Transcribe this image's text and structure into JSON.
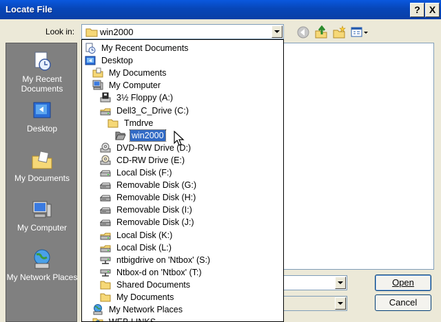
{
  "window": {
    "title": "Locate File",
    "help_label": "?",
    "close_label": "X"
  },
  "lookin": {
    "label": "Look in:",
    "value": "win2000"
  },
  "places": [
    {
      "label": "My Recent Documents",
      "icon": "recent-documents-icon"
    },
    {
      "label": "Desktop",
      "icon": "desktop-icon"
    },
    {
      "label": "My Documents",
      "icon": "my-documents-icon"
    },
    {
      "label": "My Computer",
      "icon": "my-computer-icon"
    },
    {
      "label": "My Network Places",
      "icon": "network-places-icon"
    }
  ],
  "dropdown_items": [
    {
      "label": "My Recent Documents",
      "icon": "recent-documents-icon",
      "indent": 0
    },
    {
      "label": "Desktop",
      "icon": "desktop-icon",
      "indent": 0
    },
    {
      "label": "My Documents",
      "icon": "folder-documents-icon",
      "indent": 1
    },
    {
      "label": "My Computer",
      "icon": "my-computer-icon",
      "indent": 1
    },
    {
      "label": "3½ Floppy (A:)",
      "icon": "floppy-drive-icon",
      "indent": 2
    },
    {
      "label": "Dell3_C_Drive (C:)",
      "icon": "hard-drive-icon",
      "indent": 2
    },
    {
      "label": "Tmdrve",
      "icon": "folder-icon",
      "indent": 3
    },
    {
      "label": "win2000",
      "icon": "folder-open-icon",
      "indent": 4,
      "selected": true
    },
    {
      "label": "DVD-RW Drive (D:)",
      "icon": "dvd-drive-icon",
      "indent": 2
    },
    {
      "label": "CD-RW Drive (E:)",
      "icon": "cd-drive-icon",
      "indent": 2
    },
    {
      "label": "Local Disk (F:)",
      "icon": "disk-icon",
      "indent": 2
    },
    {
      "label": "Removable Disk (G:)",
      "icon": "removable-disk-icon",
      "indent": 2
    },
    {
      "label": "Removable Disk (H:)",
      "icon": "removable-disk-icon",
      "indent": 2
    },
    {
      "label": "Removable Disk (I:)",
      "icon": "removable-disk-icon",
      "indent": 2
    },
    {
      "label": "Removable Disk (J:)",
      "icon": "removable-disk-icon",
      "indent": 2
    },
    {
      "label": "Local Disk (K:)",
      "icon": "hard-drive-icon",
      "indent": 2
    },
    {
      "label": "Local Disk (L:)",
      "icon": "hard-drive-icon",
      "indent": 2
    },
    {
      "label": "ntbigdrive on 'Ntbox' (S:)",
      "icon": "network-drive-icon",
      "indent": 2
    },
    {
      "label": "Ntbox-d on 'Ntbox' (T:)",
      "icon": "network-drive-icon",
      "indent": 2
    },
    {
      "label": "Shared Documents",
      "icon": "folder-icon",
      "indent": 2
    },
    {
      "label": "My Documents",
      "icon": "folder-icon",
      "indent": 2
    },
    {
      "label": "My Network Places",
      "icon": "network-places-icon",
      "indent": 1
    },
    {
      "label": "WEB LINKS",
      "icon": "web-links-icon",
      "indent": 1
    }
  ],
  "buttons": {
    "open": "Open",
    "cancel": "Cancel"
  },
  "colors": {
    "title_bar": "#0a58de",
    "selection": "#316ac5",
    "places_bar": "#808080",
    "dialog_face": "#ece9d8"
  }
}
